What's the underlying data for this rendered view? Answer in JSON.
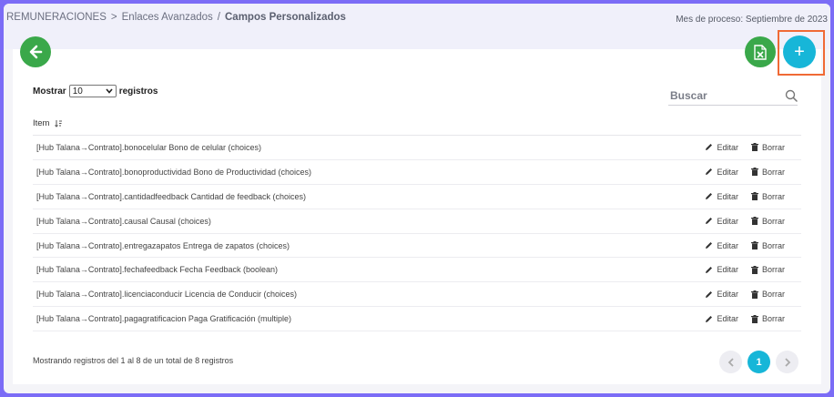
{
  "breadcrumb": {
    "items": [
      "REMUNERACIONES",
      "Enlaces Avanzados"
    ],
    "separators": [
      ">",
      "/"
    ],
    "current": "Campos Personalizados"
  },
  "process_month": "Mes de proceso: Septiembre de 2023",
  "toolbar": {
    "back_icon": "arrow-left-icon",
    "excel_icon": "excel-file-icon",
    "add_label": "+"
  },
  "table_controls": {
    "show_label": "Mostrar",
    "page_length": "10",
    "records_label": "registros",
    "search_placeholder": "Buscar"
  },
  "table": {
    "header": "Item",
    "edit_label": "Editar",
    "delete_label": "Borrar",
    "rows": [
      "[Hub Talana→Contrato].bonocelular Bono de celular (choices)",
      "[Hub Talana→Contrato].bonoproductividad Bono de Productividad (choices)",
      "[Hub Talana→Contrato].cantidadfeedback Cantidad de feedback (choices)",
      "[Hub Talana→Contrato].causal Causal (choices)",
      "[Hub Talana→Contrato].entregazapatos Entrega de zapatos (choices)",
      "[Hub Talana→Contrato].fechafeedback Fecha Feedback (boolean)",
      "[Hub Talana→Contrato].licenciaconducir Licencia de Conducir (choices)",
      "[Hub Talana→Contrato].pagagratificacion Paga Gratificación (multiple)"
    ]
  },
  "footer": {
    "info": "Mostrando registros del 1 al 8 de un total de 8 registros",
    "current_page": "1"
  },
  "colors": {
    "green": "#3aa84a",
    "cyan": "#17b6d8",
    "highlight": "#f06a35",
    "frame": "#7b6cf6"
  }
}
